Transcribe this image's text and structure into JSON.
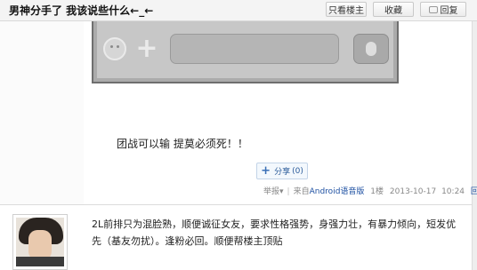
{
  "thread": {
    "title": "男神分手了  我该说些什么←_←"
  },
  "toolbar": {
    "only_author_label": "只看楼主",
    "favorite_label": "收藏",
    "reply_label": "回复"
  },
  "post": {
    "text": "团战可以输  提莫必须死！！",
    "share": {
      "label": "分享",
      "count": "(0)"
    },
    "meta": {
      "report": "举报",
      "from_prefix": "来自",
      "client": "Android语音版",
      "floor": "1楼",
      "date": "2013-10-17",
      "time": "10:24",
      "reply": "回复"
    }
  },
  "next_post": {
    "text": "2L前排只为混脸熟，顺便诚征女友，要求性格强势，身强力壮，有暴力倾向，短发优先（基友勿扰）。逢粉必回。顺便帮楼主顶贴"
  }
}
